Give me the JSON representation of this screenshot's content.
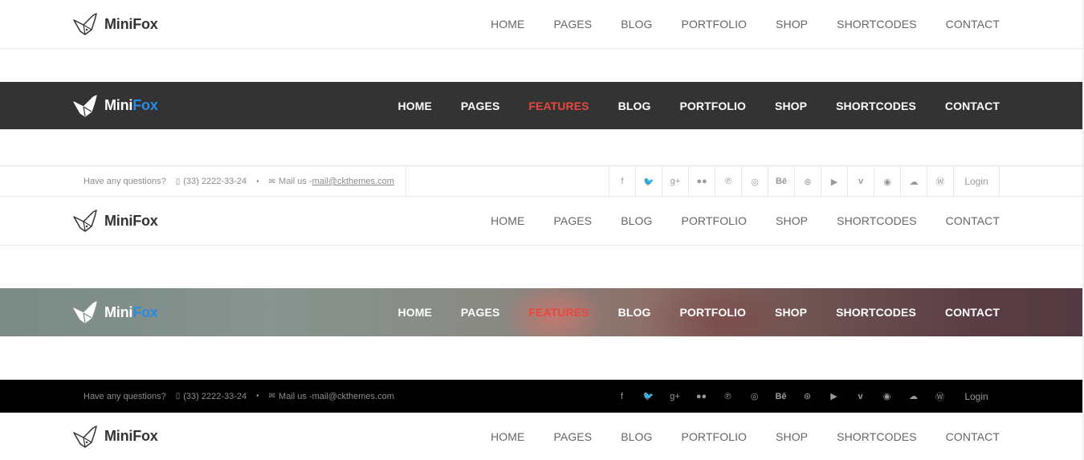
{
  "brand": {
    "name_first": "Mini",
    "name_second": "Fox",
    "accent_color": "#2b8ae3"
  },
  "colors": {
    "dark_bar": "#333333",
    "active_nav": "#e8473e",
    "nav_light_text": "#666666"
  },
  "nav_light": {
    "items": [
      "HOME",
      "PAGES",
      "BLOG",
      "PORTFOLIO",
      "SHOP",
      "SHORTCODES",
      "CONTACT"
    ]
  },
  "nav_dark": {
    "items": [
      "HOME",
      "PAGES",
      "FEATURES",
      "BLOG",
      "PORTFOLIO",
      "SHOP",
      "SHORTCODES",
      "CONTACT"
    ],
    "active": "FEATURES"
  },
  "topbar": {
    "question": "Have any questions?",
    "phone": "(33) 2222-33-24",
    "bullet": "•",
    "mail_label": "Mail us - ",
    "mail_address": "mail@ckthemes.com",
    "social_icons": [
      "facebook-icon",
      "twitter-icon",
      "google-plus-icon",
      "flickr-icon",
      "pinterest-icon",
      "instagram-icon",
      "behance-icon",
      "dribbble-icon",
      "youtube-icon",
      "vimeo-icon",
      "github-icon",
      "soundcloud-icon",
      "wordpress-icon"
    ],
    "social_glyphs": [
      "f",
      "🐦",
      "g+",
      "●●",
      "℗",
      "◎",
      "Bē",
      "⊛",
      "▶",
      "v",
      "◉",
      "☁",
      "Ⓦ"
    ],
    "login": "Login"
  }
}
